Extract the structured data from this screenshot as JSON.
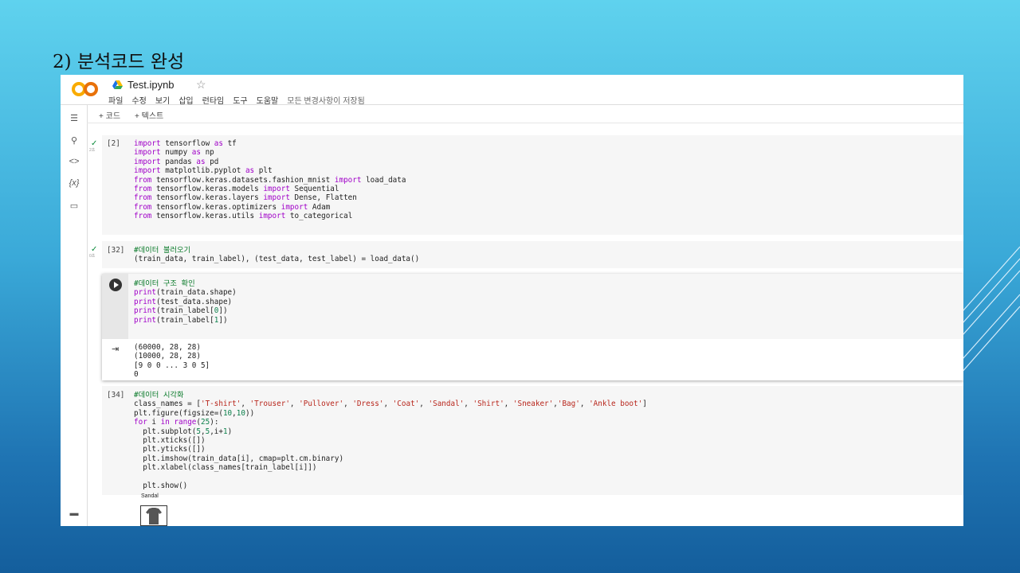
{
  "slide": {
    "title": "2) 분석코드 완성"
  },
  "colab": {
    "logo": "CO",
    "drive_icon": "google-drive-icon",
    "filename": "Test.ipynb",
    "star_icon": "☆",
    "menu": [
      "파일",
      "수정",
      "보기",
      "삽입",
      "런타임",
      "도구",
      "도움말"
    ],
    "saved_status": "모든 변경사항이 저장됨",
    "toolbar": {
      "add_code": "+ 코드",
      "add_text": "+ 텍스트"
    },
    "sidebar_icons": [
      "toc-icon",
      "search-icon",
      "code-snippets-icon",
      "variables-icon",
      "files-icon",
      "terminal-icon"
    ]
  },
  "cells": [
    {
      "exec": "[2]",
      "time": "2초",
      "code": [
        "import tensorflow as tf",
        "import numpy as np",
        "import pandas as pd",
        "import matplotlib.pyplot as plt",
        "from tensorflow.keras.datasets.fashion_mnist import load_data",
        "from tensorflow.keras.models import Sequential",
        "from tensorflow.keras.layers import Dense, Flatten",
        "from tensorflow.keras.optimizers import Adam",
        "from tensorflow.keras.utils import to_categorical"
      ]
    },
    {
      "exec": "[32]",
      "time": "0초",
      "code": [
        "#데이터 불러오기",
        "(train_data, train_label), (test_data, test_label) = load_data()"
      ]
    },
    {
      "exec": "",
      "code": [
        "#데이터 구조 확인",
        "print(train_data.shape)",
        "print(test_data.shape)",
        "print(train_label[0])",
        "print(train_label[1])"
      ],
      "output": [
        "(60000, 28, 28)",
        "(10000, 28, 28)",
        "[9 0 0 ... 3 0 5]",
        "0"
      ]
    },
    {
      "exec": "[34]",
      "code": [
        "#데이터 시각화",
        "class_names = ['T-shirt', 'Trouser', 'Pullover', 'Dress', 'Coat', 'Sandal', 'Shirt', 'Sneaker','Bag', 'Ankle boot']",
        "plt.figure(figsize=(10,10))",
        "for i in range(25):",
        "  plt.subplot(5,5,i+1)",
        "  plt.xticks([])",
        "  plt.yticks([])",
        "  plt.imshow(train_data[i], cmap=plt.cm.binary)",
        "  plt.xlabel(class_names[train_label[i]])",
        "",
        "  plt.show()"
      ],
      "figure_label": "Sandal"
    }
  ]
}
